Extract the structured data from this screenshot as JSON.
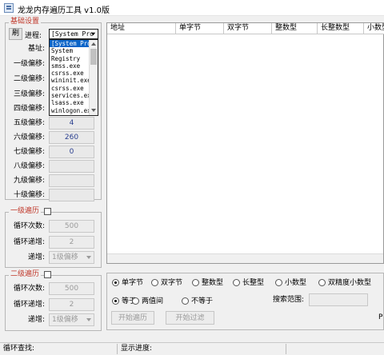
{
  "window": {
    "title": "龙龙内存遍历工具 v1.0版"
  },
  "basic": {
    "title": "基础设置",
    "refresh_label": "刷",
    "process_label": "进程:",
    "process_selected": "[System Pro",
    "process_list": [
      "[System Pro",
      "System",
      "Registry",
      "smss.exe",
      "csrss.exe",
      "wininit.exe",
      "csrss.exe",
      "services.exe",
      "lsass.exe",
      "winlogon.exe"
    ],
    "base_label": "基址:",
    "offsets": [
      {
        "label": "一级偏移:",
        "value": ""
      },
      {
        "label": "二级偏移:",
        "value": ""
      },
      {
        "label": "三级偏移:",
        "value": ""
      },
      {
        "label": "四级偏移:",
        "value": ""
      },
      {
        "label": "五级偏移:",
        "value": "4"
      },
      {
        "label": "六级偏移:",
        "value": "260"
      },
      {
        "label": "七级偏移:",
        "value": "0"
      },
      {
        "label": "八级偏移:",
        "value": ""
      },
      {
        "label": "九级偏移:",
        "value": ""
      },
      {
        "label": "十级偏移:",
        "value": ""
      }
    ]
  },
  "loop1": {
    "title": "一级遍历",
    "count_label": "循环次数:",
    "count_value": "500",
    "step_label": "循环递增:",
    "step_value": "2",
    "inc_label": "递增:",
    "inc_value": "1级偏移"
  },
  "loop2": {
    "title": "二级遍历",
    "count_label": "循环次数:",
    "count_value": "500",
    "step_label": "循环递增:",
    "step_value": "2",
    "inc_label": "递增:",
    "inc_value": "1级偏移"
  },
  "table": {
    "columns": [
      "地址",
      "单字节",
      "双字节",
      "整数型",
      "长整数型",
      "小数型"
    ]
  },
  "types": [
    "单字节",
    "双字节",
    "整数型",
    "长整型",
    "小数型",
    "双精度小数型"
  ],
  "compare": [
    "等于",
    "两值间",
    "不等于"
  ],
  "search_range_label": "搜索范围:",
  "start_traverse": "开始遍历",
  "start_filter": "开始过滤",
  "right_edge_text": "P",
  "status": {
    "loop_find": "循环查找:",
    "progress": "显示进度:"
  }
}
